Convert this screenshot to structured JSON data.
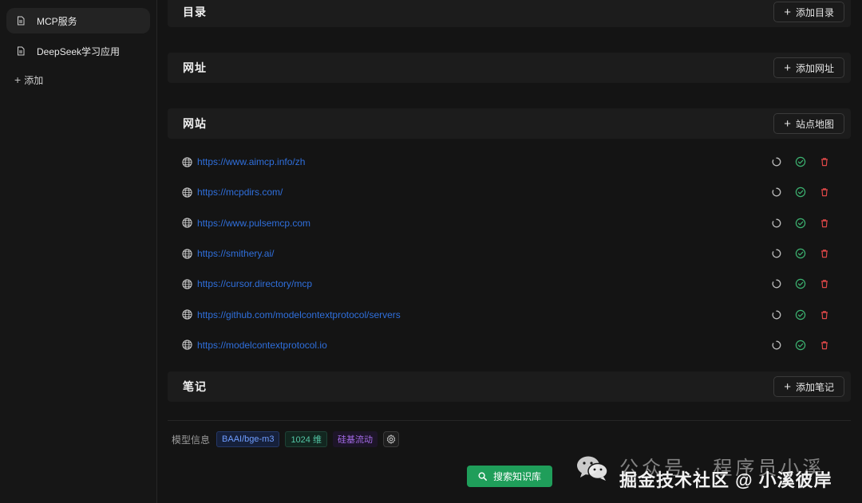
{
  "sidebar": {
    "items": [
      {
        "label": "MCP服务",
        "icon": "document-icon",
        "active": true
      },
      {
        "label": "DeepSeek学习应用",
        "icon": "document-icon",
        "active": false
      }
    ],
    "add_label": "添加"
  },
  "sections": {
    "directory": {
      "title": "目录",
      "button": "添加目录"
    },
    "url": {
      "title": "网址",
      "button": "添加网址"
    },
    "website": {
      "title": "网站",
      "button": "站点地图"
    },
    "notes": {
      "title": "笔记",
      "button": "添加笔记"
    }
  },
  "websites": [
    "https://www.aimcp.info/zh",
    "https://mcpdirs.com/",
    "https://www.pulsemcp.com",
    "https://smithery.ai/",
    "https://cursor.directory/mcp",
    "https://github.com/modelcontextprotocol/servers",
    "https://modelcontextprotocol.io"
  ],
  "row_icons": [
    "refresh-icon",
    "check-circle-icon",
    "trash-icon"
  ],
  "model": {
    "label": "模型信息",
    "name": "BAAI/bge-m3",
    "dimensions": "1024 维",
    "provider": "硅基流动"
  },
  "search_button": "搜索知识库",
  "watermark": {
    "line1": "公众号 · 程序员小溪",
    "line2": "掘金技术社区 @ 小溪彼岸"
  },
  "colors": {
    "link": "#2f6fdc",
    "success": "#3cb371",
    "danger": "#e04848",
    "primary_button": "#1f9e5a"
  }
}
